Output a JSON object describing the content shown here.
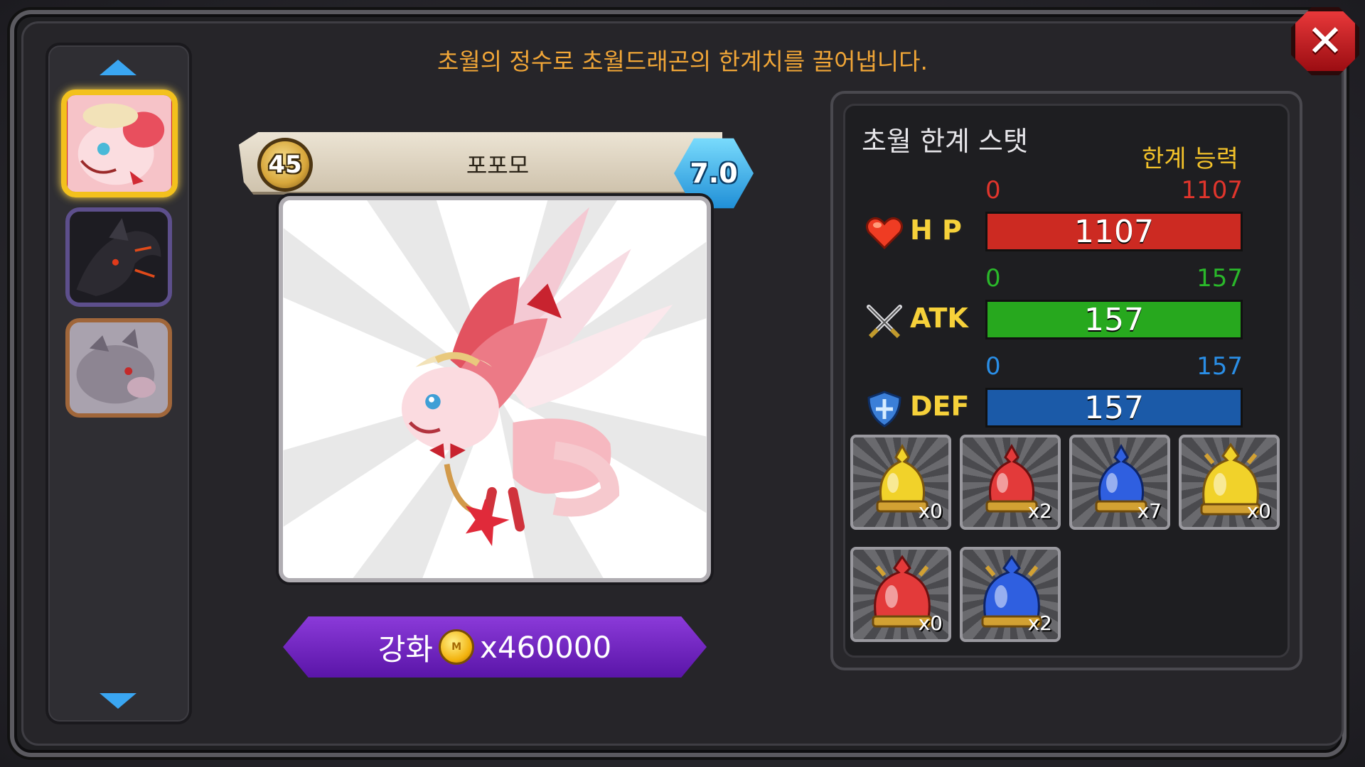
{
  "header": {
    "subtitle": "초월의 정수로 초월드래곤의 한계치를 끌어냅니다.",
    "close_icon": "close-icon"
  },
  "monster_list": {
    "up_icon": "arrow-up-icon",
    "down_icon": "arrow-down-icon",
    "items": [
      {
        "name": "pink-dragon",
        "selected": true
      },
      {
        "name": "black-dragon",
        "selected": false
      },
      {
        "name": "gray-dragon",
        "selected": false
      }
    ]
  },
  "monster": {
    "level": "45",
    "name": "포포모",
    "grade": "7.0"
  },
  "upgrade": {
    "label_prefix": "강화",
    "cost": "x460000",
    "coin_mark": "M"
  },
  "stats": {
    "title": "초월 한계 스탯",
    "limit_label": "한계 능력",
    "rows": [
      {
        "name": "H P",
        "min": "0",
        "max": "1107",
        "value": "1107",
        "fill": 1.0,
        "color": "#cc2a22",
        "range_color": "#e0352c",
        "icon": "heart-icon"
      },
      {
        "name": "ATK",
        "min": "0",
        "max": "157",
        "value": "157",
        "fill": 1.0,
        "color": "#27a81e",
        "range_color": "#2ab82a",
        "icon": "crossed-swords-icon"
      },
      {
        "name": "DEF",
        "min": "0",
        "max": "157",
        "value": "157",
        "fill": 1.0,
        "color": "#1b5aa8",
        "range_color": "#2a8ee6",
        "icon": "shield-icon"
      }
    ]
  },
  "items": [
    {
      "color": "#f1d22a",
      "count": "x0",
      "icon": "yellow-potion-icon"
    },
    {
      "color": "#e33a3a",
      "count": "x2",
      "icon": "red-potion-icon"
    },
    {
      "color": "#2f5fe0",
      "count": "x7",
      "icon": "blue-potion-icon"
    },
    {
      "color": "#f1d22a",
      "count": "x0",
      "icon": "large-yellow-potion-icon"
    },
    {
      "color": "#e33a3a",
      "count": "x0",
      "icon": "large-red-potion-icon"
    },
    {
      "color": "#2f5fe0",
      "count": "x2",
      "icon": "large-blue-potion-icon"
    }
  ]
}
